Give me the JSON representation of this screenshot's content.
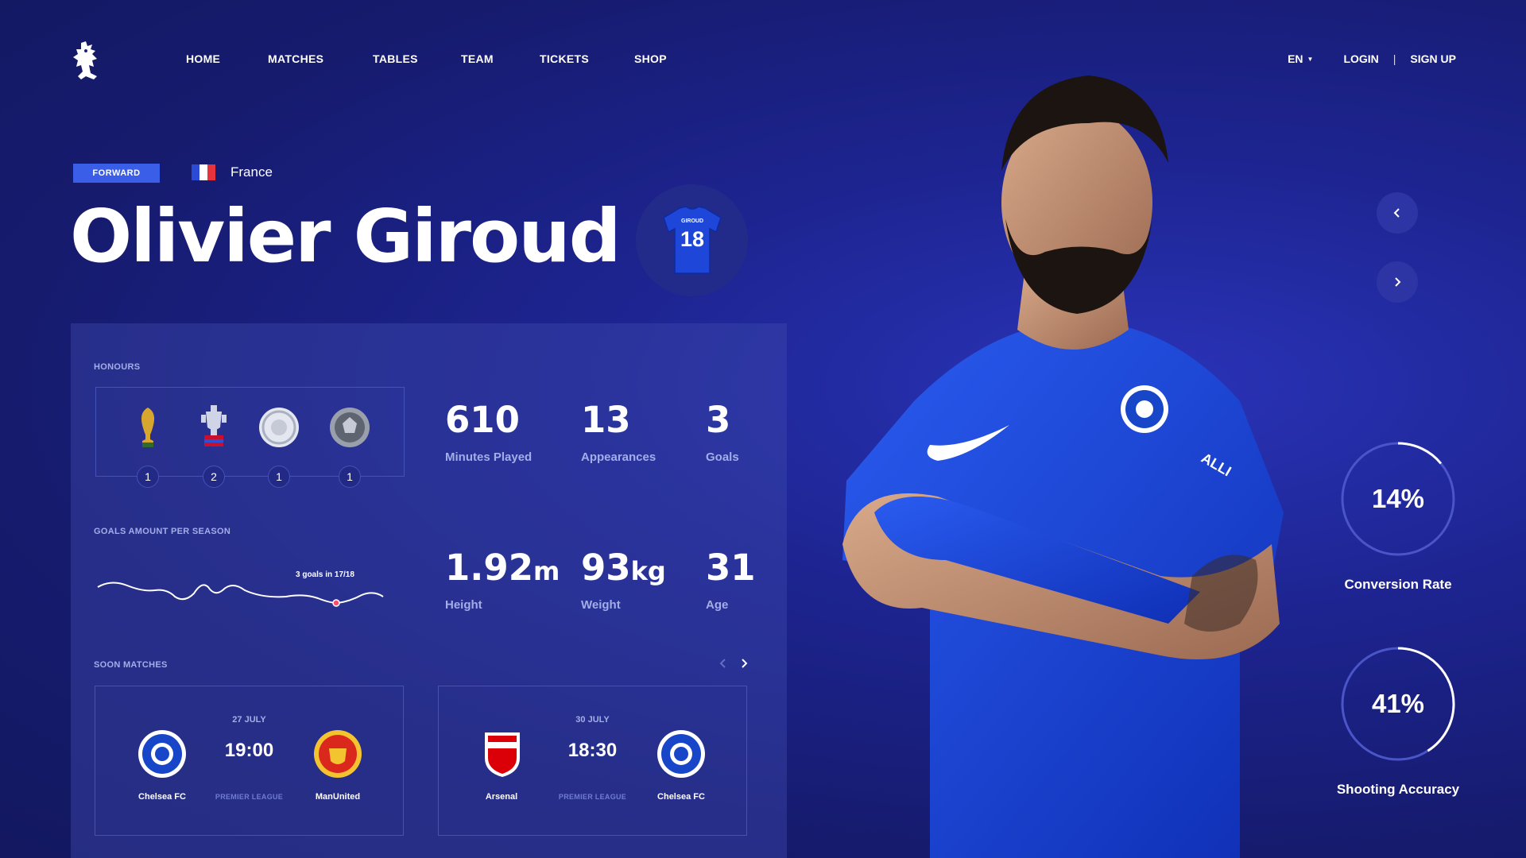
{
  "nav": {
    "items": [
      "HOME",
      "MATCHES",
      "TABLES",
      "TEAM",
      "TICKETS",
      "SHOP"
    ],
    "lang": "EN",
    "login": "LOGIN",
    "separator": "|",
    "signup": "SIGN UP"
  },
  "player": {
    "position": "FORWARD",
    "country": "France",
    "name": "Olivier Giroud",
    "shirt_name": "GIROUD",
    "shirt_number": "18"
  },
  "honours": {
    "label": "HONOURS",
    "trophies": [
      {
        "icon": "world-cup-trophy-icon",
        "count": "1"
      },
      {
        "icon": "fa-cup-trophy-icon",
        "count": "2"
      },
      {
        "icon": "community-shield-icon",
        "count": "1"
      },
      {
        "icon": "league-medal-icon",
        "count": "1"
      }
    ]
  },
  "stats": {
    "minutes": {
      "value": "610",
      "label": "Minutes Played"
    },
    "appearances": {
      "value": "13",
      "label": "Appearances"
    },
    "goals": {
      "value": "3",
      "label": "Goals"
    },
    "height": {
      "value": "1.92",
      "unit": "m",
      "label": "Height"
    },
    "weight": {
      "value": "93",
      "unit": "kg",
      "label": "Weight"
    },
    "age": {
      "value": "31",
      "label": "Age"
    }
  },
  "goals_chart": {
    "label": "GOALS AMOUNT PER SEASON",
    "note": "3 goals in 17/18"
  },
  "matches": {
    "label": "SOON MATCHES",
    "items": [
      {
        "date": "27 JULY",
        "time": "19:00",
        "league": "PREMIER LEAGUE",
        "home": "Chelsea FC",
        "away": "ManUnited"
      },
      {
        "date": "30 JULY",
        "time": "18:30",
        "league": "PREMIER LEAGUE",
        "home": "Arsenal",
        "away": "Chelsea FC"
      }
    ]
  },
  "rings": {
    "conversion": {
      "value": "14%",
      "label": "Conversion Rate",
      "percent": 14
    },
    "shooting": {
      "value": "41%",
      "label": "Shooting Accuracy",
      "percent": 41
    }
  },
  "colors": {
    "background": "#1a2080",
    "accent": "#3a5ee8",
    "ring_track": "#4a55c8",
    "text_muted": "#a3aee8"
  }
}
